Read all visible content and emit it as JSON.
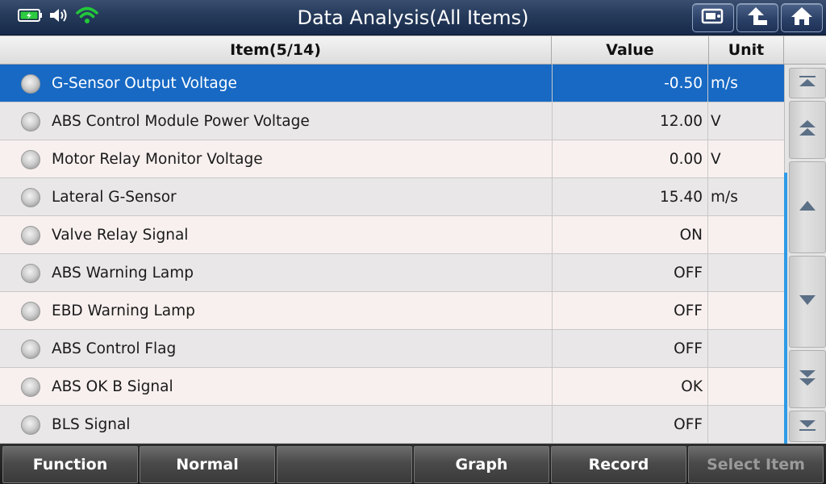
{
  "header": {
    "title": "Data Analysis(All Items)"
  },
  "status_icons": [
    "battery-charging-icon",
    "speaker-icon",
    "wifi-icon"
  ],
  "top_buttons": [
    "video-icon",
    "back-arrow-icon",
    "home-icon"
  ],
  "table": {
    "columns": {
      "item": "Item(5/14)",
      "value": "Value",
      "unit": "Unit"
    },
    "rows": [
      {
        "name": "G-Sensor Output Voltage",
        "value": "-0.50",
        "unit": "m/s",
        "selected": true
      },
      {
        "name": "ABS Control Module Power Voltage",
        "value": "12.00",
        "unit": "V"
      },
      {
        "name": "Motor Relay Monitor Voltage",
        "value": "0.00",
        "unit": "V"
      },
      {
        "name": "Lateral G-Sensor",
        "value": "15.40",
        "unit": "m/s"
      },
      {
        "name": "Valve Relay Signal",
        "value": "ON",
        "unit": ""
      },
      {
        "name": "ABS Warning Lamp",
        "value": "OFF",
        "unit": ""
      },
      {
        "name": "EBD Warning Lamp",
        "value": "OFF",
        "unit": ""
      },
      {
        "name": "ABS Control Flag",
        "value": "OFF",
        "unit": ""
      },
      {
        "name": "ABS OK B Signal",
        "value": "OK",
        "unit": ""
      },
      {
        "name": "BLS Signal",
        "value": "OFF",
        "unit": ""
      }
    ]
  },
  "scroll_buttons": [
    "scroll-top-icon",
    "page-up-icon",
    "line-up-icon",
    "line-down-icon",
    "page-down-icon",
    "scroll-bottom-icon"
  ],
  "footer": {
    "buttons": [
      {
        "label": "Function",
        "enabled": true
      },
      {
        "label": "Normal",
        "enabled": true
      },
      {
        "label": "",
        "enabled": true
      },
      {
        "label": "Graph",
        "enabled": true
      },
      {
        "label": "Record",
        "enabled": true
      },
      {
        "label": "Select Item",
        "enabled": false
      }
    ]
  },
  "colors": {
    "selected_row": "#1769c4",
    "scroll_indicator": "#2f9be6",
    "wifi": "#22c93a",
    "battery": "#2ecc40"
  }
}
